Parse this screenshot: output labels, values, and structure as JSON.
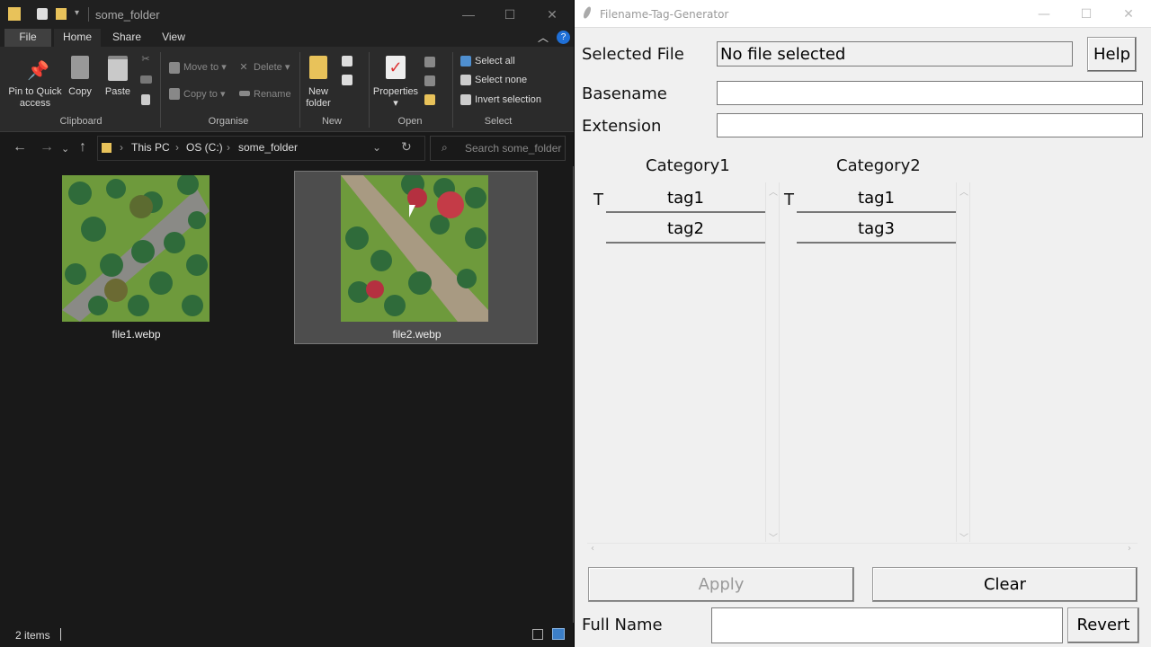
{
  "explorer": {
    "title": "some_folder",
    "tabs": [
      "File",
      "Home",
      "Share",
      "View"
    ],
    "ribbon": {
      "clipboard": {
        "pin": "Pin to Quick access",
        "copy": "Copy",
        "paste": "Paste",
        "label": "Clipboard"
      },
      "organise": {
        "move_to": "Move to",
        "copy_to": "Copy to",
        "delete": "Delete",
        "rename": "Rename",
        "label": "Organise"
      },
      "new": {
        "new_folder": "New folder",
        "label": "New"
      },
      "open": {
        "properties": "Properties",
        "label": "Open"
      },
      "select": {
        "select_all": "Select all",
        "select_none": "Select none",
        "invert": "Invert selection",
        "label": "Select"
      }
    },
    "breadcrumb": [
      "This PC",
      "OS (C:)",
      "some_folder"
    ],
    "search_placeholder": "Search some_folder",
    "files": [
      {
        "name": "file1.webp"
      },
      {
        "name": "file2.webp",
        "selected": true
      }
    ],
    "status": "2 items"
  },
  "app": {
    "title": "Filename-Tag-Generator",
    "selected_file_label": "Selected File",
    "selected_file_value": "No file selected",
    "help": "Help",
    "basename_label": "Basename",
    "basename_value": "",
    "extension_label": "Extension",
    "extension_value": "",
    "categories": [
      {
        "name": "Category1",
        "mode": "T",
        "tags": [
          "tag1",
          "tag2"
        ]
      },
      {
        "name": "Category2",
        "mode": "T",
        "tags": [
          "tag1",
          "tag3"
        ]
      }
    ],
    "apply": "Apply",
    "clear": "Clear",
    "full_name_label": "Full Name",
    "full_name_value": "",
    "revert": "Revert"
  }
}
